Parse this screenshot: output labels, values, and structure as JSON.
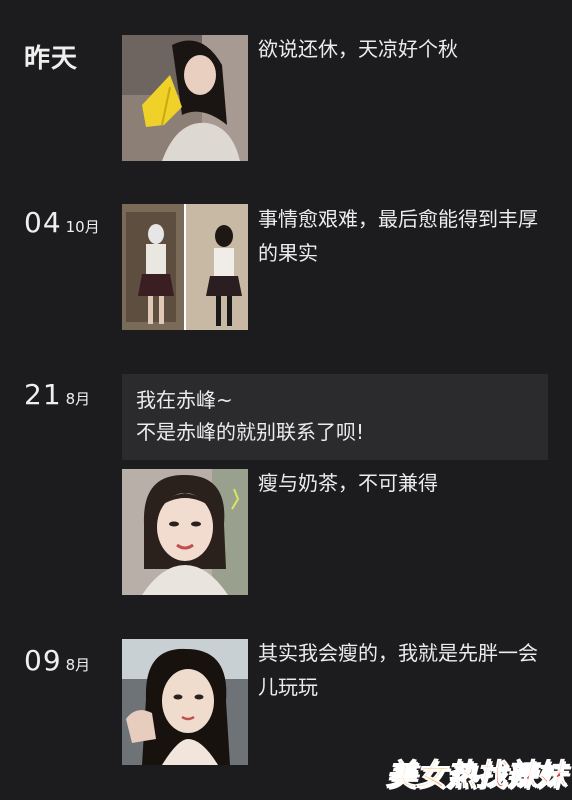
{
  "posts": [
    {
      "date_label": "昨天",
      "caption": "欲说还休，天凉好个秋",
      "photo": "girl-with-yellow-leaf-photo"
    },
    {
      "day": "04",
      "month": "10月",
      "caption": "事情愈艰难，最后愈能得到丰厚的果实",
      "photo": "mirror-selfie-collage-photo"
    },
    {
      "day": "21",
      "month": "8月",
      "text_line1": "我在赤峰~",
      "text_line2": "不是赤峰的就别联系了呗!",
      "caption": "瘦与奶茶，不可兼得",
      "photo": "portrait-selfie-photo"
    },
    {
      "day": "09",
      "month": "8月",
      "caption": "其实我会瘦的，我就是先胖一会儿玩玩",
      "photo": "car-selfie-photo"
    }
  ],
  "watermark": {
    "part1": "美女热",
    "part2": "找辣妹"
  }
}
